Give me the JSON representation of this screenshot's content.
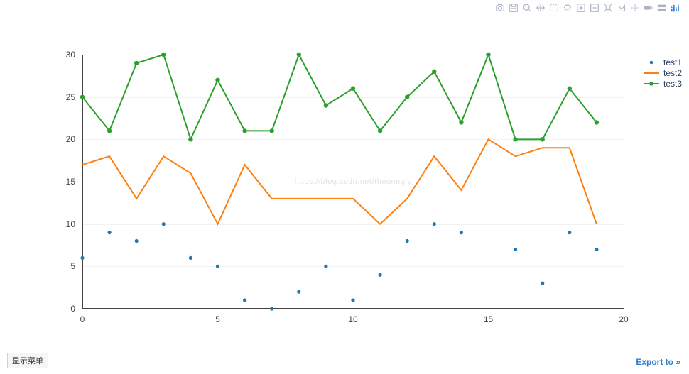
{
  "ui": {
    "menu_button": "显示菜单",
    "export_label": "Export to »"
  },
  "chart_data": {
    "type": "line",
    "x": [
      0,
      1,
      2,
      3,
      4,
      5,
      6,
      7,
      8,
      9,
      10,
      11,
      12,
      13,
      14,
      15,
      16,
      17,
      18,
      19
    ],
    "xlim": [
      0,
      20
    ],
    "ylim": [
      0,
      30
    ],
    "x_ticks": [
      0,
      5,
      10,
      15,
      20
    ],
    "y_ticks": [
      0,
      5,
      10,
      15,
      20,
      25,
      30
    ],
    "xlabel": "",
    "ylabel": "",
    "title": "",
    "legend_position": "right",
    "watermark": "https://blog.csdn.net/theonegis",
    "series": [
      {
        "name": "test1",
        "mode": "markers",
        "color": "#1f77b4",
        "values": [
          6,
          9,
          8,
          10,
          6,
          5,
          1,
          0,
          2,
          5,
          1,
          4,
          8,
          10,
          9,
          null,
          7,
          3,
          9,
          7
        ]
      },
      {
        "name": "test2",
        "mode": "lines",
        "color": "#ff7f0e",
        "values": [
          17,
          18,
          13,
          18,
          16,
          10,
          17,
          13,
          13,
          13,
          13,
          10,
          13,
          18,
          14,
          20,
          18,
          19,
          19,
          10
        ]
      },
      {
        "name": "test3",
        "mode": "lines+markers",
        "color": "#2ca02c",
        "values": [
          25,
          21,
          29,
          30,
          20,
          27,
          21,
          21,
          30,
          24,
          26,
          21,
          25,
          28,
          22,
          30,
          20,
          20,
          26,
          22
        ]
      }
    ]
  }
}
